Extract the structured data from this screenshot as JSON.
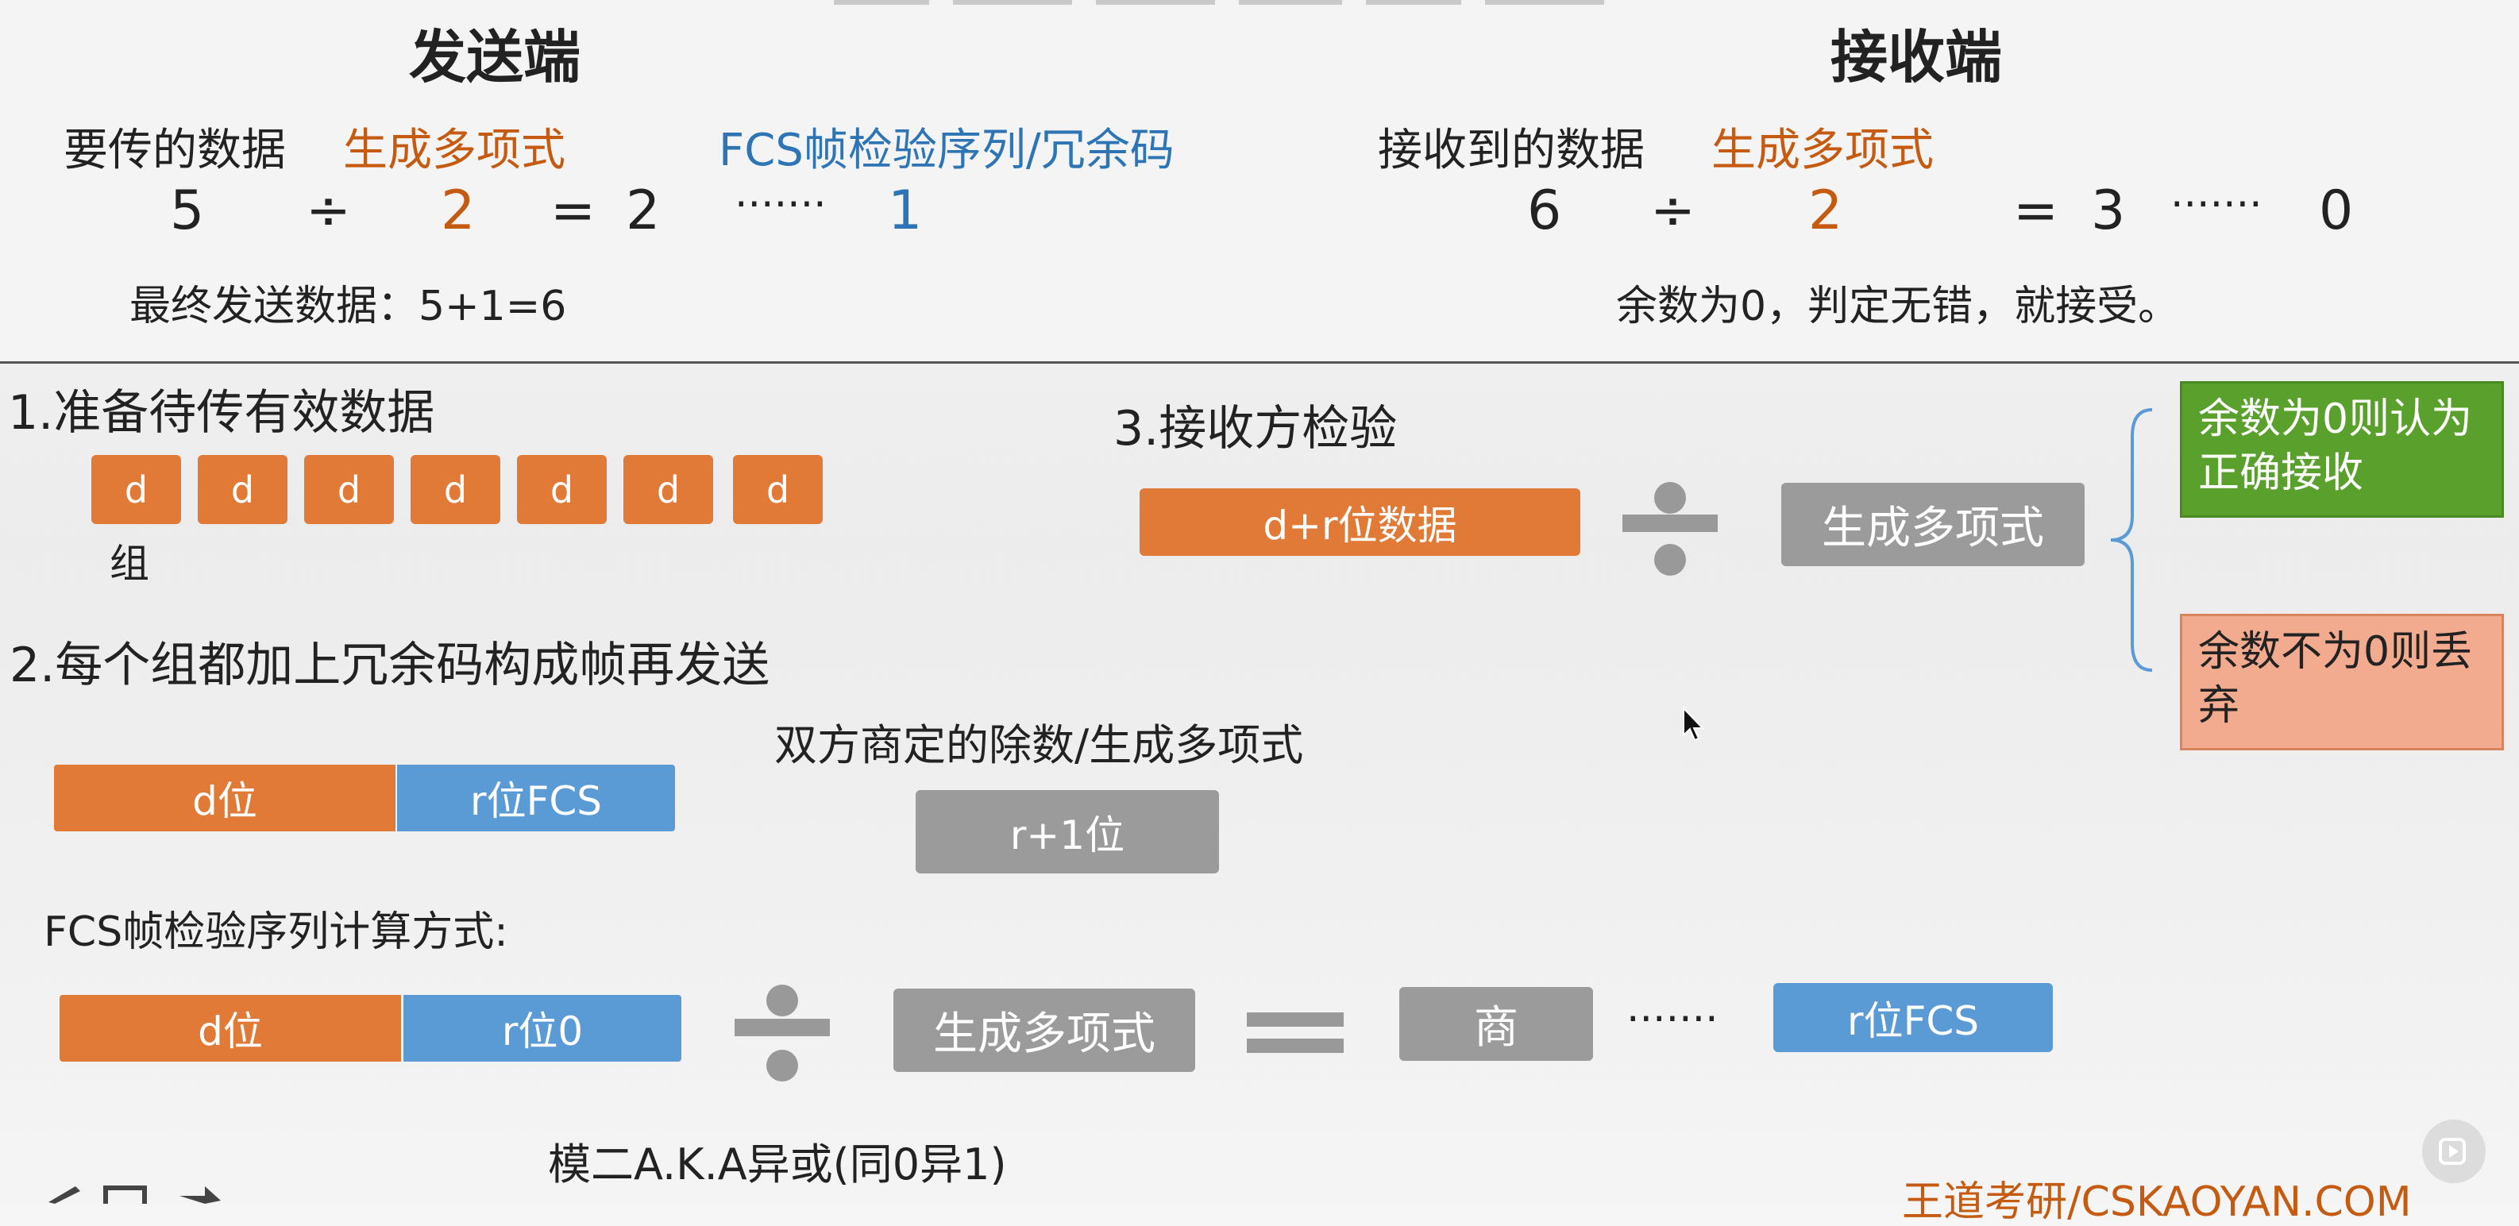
{
  "sender": {
    "title": "发送端",
    "data_label": "要传的数据",
    "poly_label": "生成多项式",
    "fcs_label": "FCS帧检验序列/冗余码",
    "eq": {
      "dividend": "5",
      "div": "÷",
      "divisor": "2",
      "equals": "=",
      "quotient": "2",
      "dots": "·······",
      "remainder": "1"
    },
    "final": "最终发送数据：5+1=6"
  },
  "receiver": {
    "title": "接收端",
    "data_label": "接收到的数据",
    "poly_label": "生成多项式",
    "eq": {
      "dividend": "6",
      "div": "÷",
      "divisor": "2",
      "equals": "=",
      "quotient": "3",
      "dots": "·······",
      "remainder": "0"
    },
    "result": "余数为0，判定无错，就接受。"
  },
  "step1": {
    "title": "1.准备待传有效数据",
    "blocks": [
      "d",
      "d",
      "d",
      "d",
      "d",
      "d",
      "d"
    ],
    "group_label": "组"
  },
  "step2": {
    "title": "2.每个组都加上冗余码构成帧再发送",
    "frame_d": "d位",
    "frame_r": "r位FCS",
    "divisor_caption": "双方商定的除数/生成多项式",
    "divisor_box": "r+1位"
  },
  "fcs_calc": {
    "title": "FCS帧检验序列计算方式:",
    "d_box": "d位",
    "r_box": "r位0",
    "poly_box": "生成多项式",
    "quotient_box": "商",
    "dots": "·······",
    "result_box": "r位FCS",
    "note": "模二A.K.A异或(同0异1)"
  },
  "step3": {
    "title": "3.接收方检验",
    "data_box": "d+r位数据",
    "poly_box": "生成多项式",
    "ok_box": "余数为0则认为正确接收",
    "bad_box": "余数不为0则丢弃"
  },
  "watermark": "王道考研/CSKAOYAN.COM",
  "colors": {
    "orange": "#e07a36",
    "blue": "#5b9bd5",
    "gray": "#9b9b9b",
    "green": "#5aa02c",
    "salmon": "#f2ab8f"
  }
}
